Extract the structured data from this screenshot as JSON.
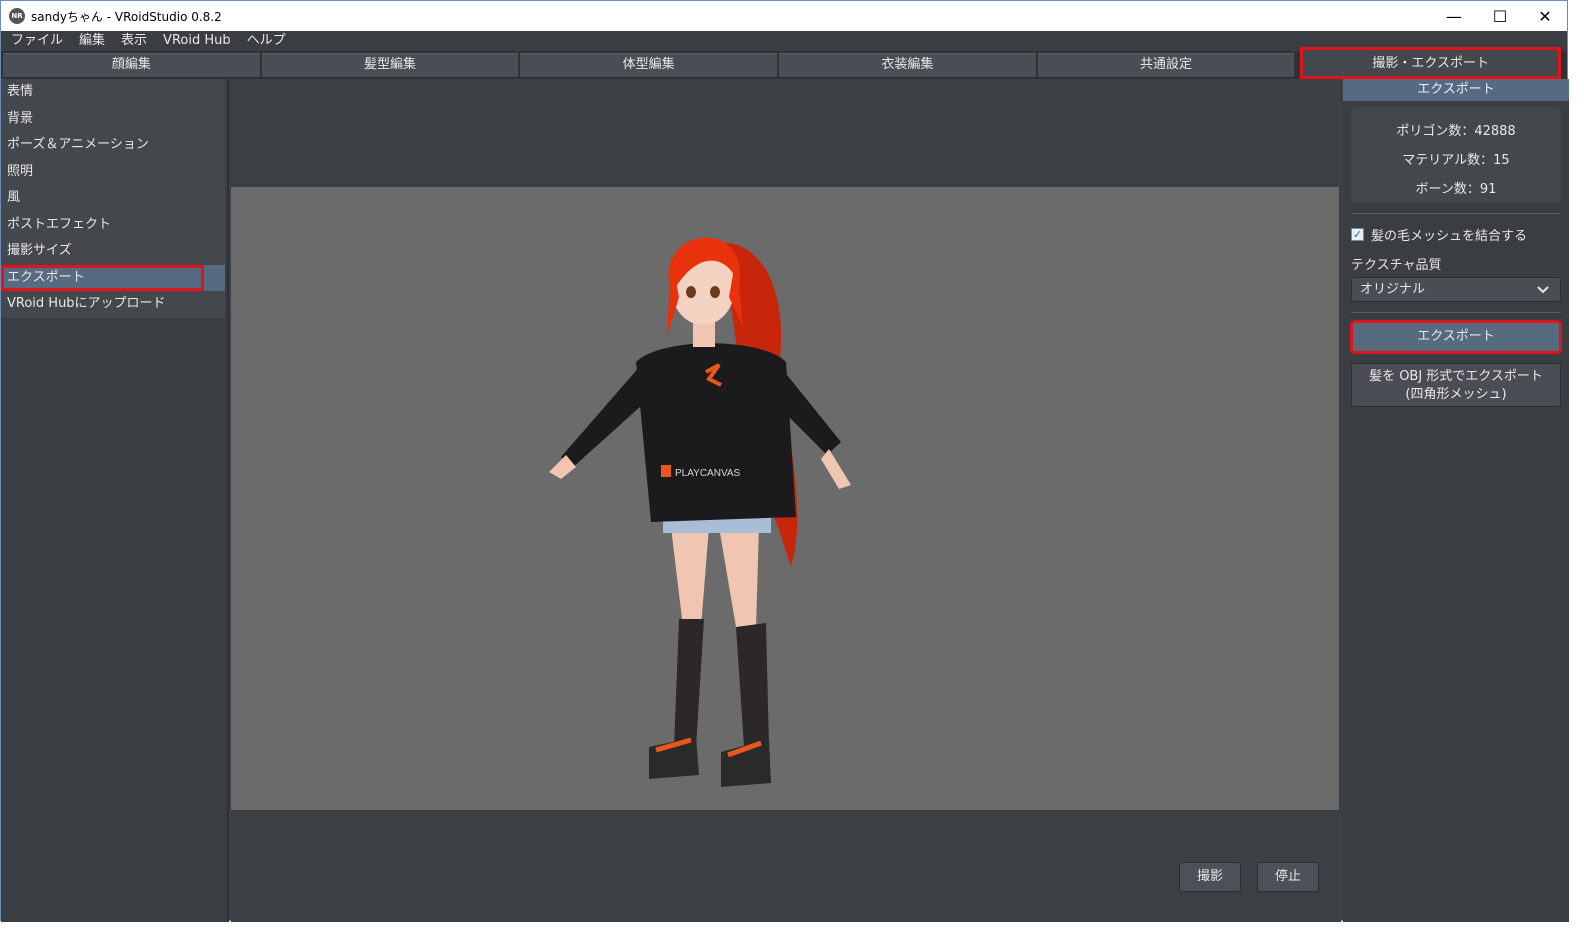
{
  "titlebar": {
    "icon_text": "NR",
    "title": "sandyちゃん - VRoidStudio 0.8.2",
    "minimize": "—",
    "maximize": "☐",
    "close": "✕"
  },
  "menubar": {
    "items": [
      "ファイル",
      "編集",
      "表示",
      "VRoid Hub",
      "ヘルプ"
    ]
  },
  "tabs": [
    {
      "label": "顔編集"
    },
    {
      "label": "髪型編集"
    },
    {
      "label": "体型編集"
    },
    {
      "label": "衣装編集"
    },
    {
      "label": "共通設定"
    },
    {
      "label": "撮影・エクスポート",
      "active": true
    }
  ],
  "sidebar": {
    "items": [
      {
        "label": "表情"
      },
      {
        "label": "背景"
      },
      {
        "label": "ポーズ＆アニメーション"
      },
      {
        "label": "照明"
      },
      {
        "label": "風"
      },
      {
        "label": "ポストエフェクト"
      },
      {
        "label": "撮影サイズ"
      },
      {
        "label": "エクスポート",
        "active": true
      },
      {
        "label": "VRoid Hubにアップロード"
      }
    ]
  },
  "viewport": {
    "hoodie_logo_text": "PLAYCANVAS",
    "capture_button": "撮影",
    "stop_button": "停止"
  },
  "panel": {
    "header": "エクスポート",
    "polygons": "ポリゴン数：42888",
    "materials": "マテリアル数：15",
    "bones": "ボーン数：91",
    "combine_hair_label": "髪の毛メッシュを結合する",
    "combine_hair_checked": true,
    "texture_quality_label": "テクスチャ品質",
    "texture_quality_value": "オリジナル",
    "export_button": "エクスポート",
    "export_obj_line1": "髪を OBJ 形式でエクスポート",
    "export_obj_line2": "(四角形メッシュ)"
  },
  "colors": {
    "accent": "#566a80",
    "highlight": "#e0151b",
    "hair": "#e8320c",
    "hoodie": "#1b1b1d"
  }
}
